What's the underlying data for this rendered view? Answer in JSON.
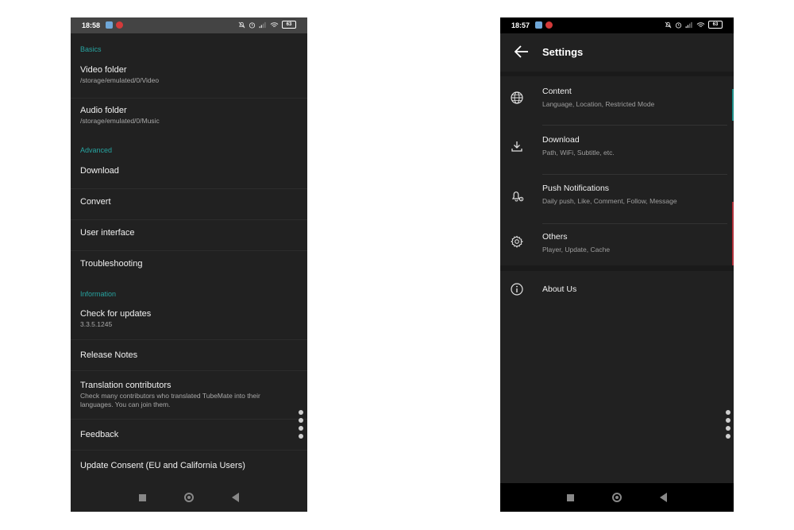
{
  "left_phone": {
    "status_time": "18:58",
    "battery": "63",
    "sections": [
      {
        "title": "Basics",
        "items": [
          {
            "title": "Video folder",
            "subtitle": "/storage/emulated/0/Video"
          },
          {
            "title": "Audio folder",
            "subtitle": "/storage/emulated/0/Music"
          }
        ]
      },
      {
        "title": "Advanced",
        "items": [
          {
            "title": "Download"
          },
          {
            "title": "Convert"
          },
          {
            "title": "User interface"
          },
          {
            "title": "Troubleshooting"
          }
        ]
      },
      {
        "title": "Information",
        "items": [
          {
            "title": "Check for updates",
            "subtitle": "3.3.5.1245"
          },
          {
            "title": "Release Notes"
          },
          {
            "title": "Translation contributors",
            "subtitle": "Check many contributors who translated TubeMate into their languages. You can join them."
          },
          {
            "title": "Feedback"
          },
          {
            "title": "Update Consent (EU and California Users)"
          }
        ]
      }
    ]
  },
  "right_phone": {
    "status_time": "18:57",
    "battery": "63",
    "header": {
      "title": "Settings",
      "back_icon": "arrow-left-icon"
    },
    "items": [
      {
        "icon": "globe-icon",
        "label": "Content",
        "subtitle": "Language, Location, Restricted Mode"
      },
      {
        "icon": "download-icon",
        "label": "Download",
        "subtitle": "Path, WiFi, Subtitle, etc."
      },
      {
        "icon": "bell-gear-icon",
        "label": "Push Notifications",
        "subtitle": "Daily push, Like, Comment, Follow, Message"
      },
      {
        "icon": "gear-icon",
        "label": "Others",
        "subtitle": "Player, Update, Cache"
      },
      {
        "icon": "info-icon",
        "label": "About Us"
      }
    ]
  },
  "colors": {
    "section_accent": "#27a3a0",
    "background": "#212121"
  }
}
